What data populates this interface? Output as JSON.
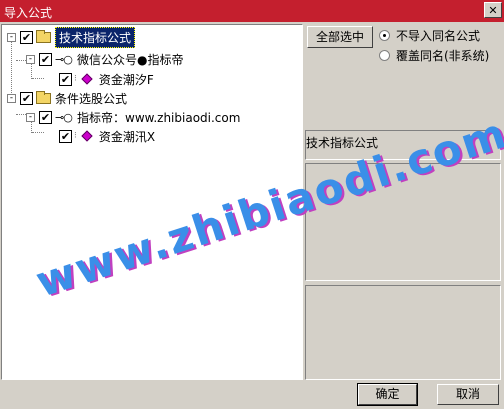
{
  "window": {
    "title": "导入公式",
    "close_glyph": "✕"
  },
  "tree": {
    "nodes": [
      {
        "label": "技术指标公式",
        "checked": "✔",
        "expander": "-",
        "selected": true
      },
      {
        "label": "微信公众号●指标帝",
        "checked": "✔",
        "expander": "-"
      },
      {
        "label": "资金潮汐F",
        "checked": "✔"
      },
      {
        "label": "条件选股公式",
        "checked": "✔",
        "expander": "-"
      },
      {
        "label": "指标帝：www.zhibiaodi.com",
        "checked": "✔",
        "expander": "-"
      },
      {
        "label": "资金潮汛X",
        "checked": "✔"
      }
    ]
  },
  "buttons": {
    "select_all": "全部选中",
    "ok": "确定",
    "cancel": "取消"
  },
  "options": [
    {
      "label": "不导入同名公式",
      "selected": true
    },
    {
      "label": "覆盖同名(非系统)",
      "selected": false
    }
  ],
  "info": {
    "category_label": "技术指标公式"
  },
  "watermark": "www.zhibiaodi.com",
  "colors": {
    "titlebar": "#c41f2e",
    "selection": "#0a246a",
    "watermark": "#3a8fe8"
  }
}
